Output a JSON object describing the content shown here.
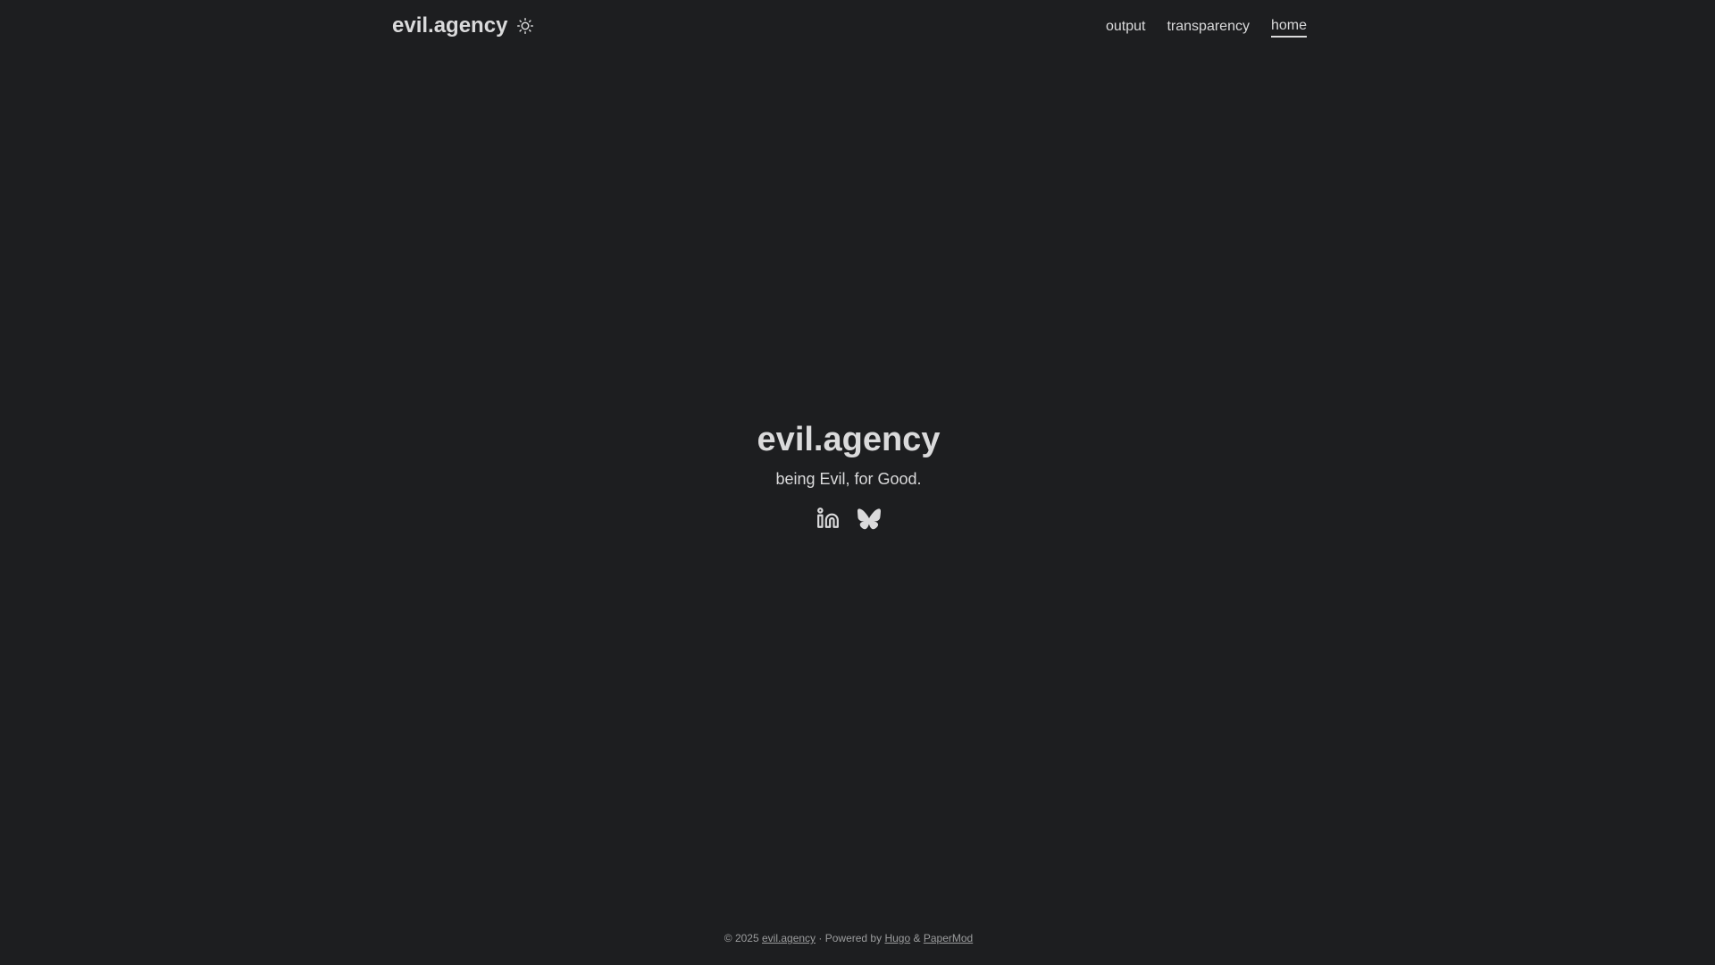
{
  "header": {
    "logo_text": "evil.agency",
    "theme_toggle_icon": "sun-icon",
    "menu": [
      {
        "label": "output"
      },
      {
        "label": "transparency"
      },
      {
        "label": "home",
        "active": true
      }
    ]
  },
  "hero": {
    "title": "evil.agency",
    "subtitle": "being Evil, for Good.",
    "social": [
      {
        "icon": "linkedin-icon"
      },
      {
        "icon": "bluesky-icon"
      }
    ]
  },
  "footer": {
    "copyright": "© 2025",
    "site_link": "evil.agency",
    "separator": "·",
    "powered_by": "Powered by",
    "hugo_link": "Hugo",
    "amp": "&",
    "theme_link": "PaperMod"
  },
  "colors": {
    "background": "#1d1e20",
    "text": "#dadadb",
    "footer_text": "#9b9c9d"
  }
}
